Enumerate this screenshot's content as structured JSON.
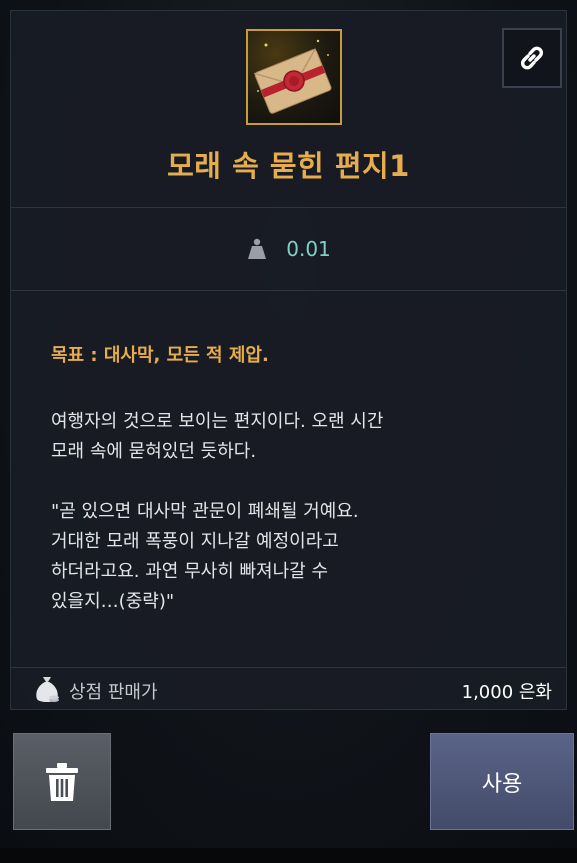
{
  "item": {
    "name": "모래 속 묻힌 편지1",
    "icon": "sealed-letter-icon",
    "weight": "0.01"
  },
  "description": {
    "objective": "목표 : 대사막, 모든 적 제압.",
    "paragraph1": "여행자의 것으로 보이는 편지이다. 오랜 시간\n모래 속에 묻혀있던 듯하다.",
    "paragraph2": "\"곧 있으면 대사막 관문이 폐쇄될 거예요.\n거대한 모래 폭풍이 지나갈 예정이라고\n하더라고요. 과연 무사히 빠져나갈 수\n있을지…(중략)\""
  },
  "price": {
    "label": "상점 판매가",
    "value": "1,000 은화"
  },
  "actions": {
    "use_label": "사용",
    "delete_icon": "trash-icon",
    "link_icon": "link-icon"
  },
  "colors": {
    "title": "#e5ad4d",
    "weight": "#7fd0c6",
    "use_button": "#4f5878",
    "delete_button": "#4d5158"
  }
}
